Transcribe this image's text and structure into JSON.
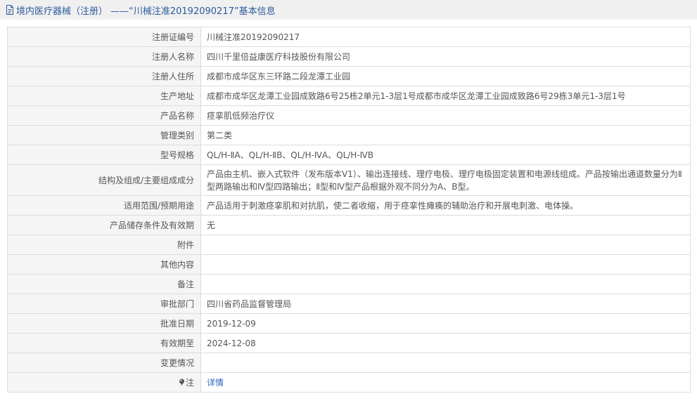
{
  "header": {
    "title": "境内医疗器械（注册） ——“川械注准20192090217”基本信息"
  },
  "rows": [
    {
      "label": "注册证编号",
      "value": "川械注准20192090217"
    },
    {
      "label": "注册人名称",
      "value": "四川千里倍益康医疗科技股份有限公司"
    },
    {
      "label": "注册人住所",
      "value": "成都市成华区东三环路二段龙潭工业园"
    },
    {
      "label": "生产地址",
      "value": "成都市成华区龙潭工业园成致路6号25栋2单元1-3层1号成都市成华区龙潭工业园成致路6号29栋3单元1-3层1号"
    },
    {
      "label": "产品名称",
      "value": "痉挛肌低频治疗仪"
    },
    {
      "label": "管理类别",
      "value": "第二类"
    },
    {
      "label": "型号规格",
      "value": "QL/H-ⅡA、QL/H-ⅡB、QL/H-ⅣA、QL/H-ⅣB"
    },
    {
      "label": "结构及组成/主要组成成分",
      "value": "产品由主机、嵌入式软件（发布版本V1）、输出连接线、理疗电极、理疗电极固定装置和电源线组成。产品按输出通道数量分为Ⅱ型两路输出和Ⅳ型四路输出；Ⅱ型和Ⅳ型产品根据外观不同分为A、B型。"
    },
    {
      "label": "适用范围/预期用途",
      "value": "产品适用于刺激痉挛肌和对抗肌，使二者收缩，用于痉挛性瘫痪的辅助治疗和开展电刺激、电体操。"
    },
    {
      "label": "产品储存条件及有效期",
      "value": "无"
    },
    {
      "label": "附件",
      "value": ""
    },
    {
      "label": "其他内容",
      "value": ""
    },
    {
      "label": "备注",
      "value": ""
    },
    {
      "label": "审批部门",
      "value": "四川省药品监督管理局"
    },
    {
      "label": "批准日期",
      "value": "2019-12-09"
    },
    {
      "label": "有效期至",
      "value": "2024-12-08"
    },
    {
      "label": "变更情况",
      "value": ""
    }
  ],
  "note": {
    "label": "注",
    "link": "详情"
  },
  "colors": {
    "header_bg": "#f0f0f0",
    "header_text": "#2d5b9a",
    "label_bg": "#f5f5f5",
    "border": "#dcdcdc",
    "link": "#2b66c0"
  }
}
